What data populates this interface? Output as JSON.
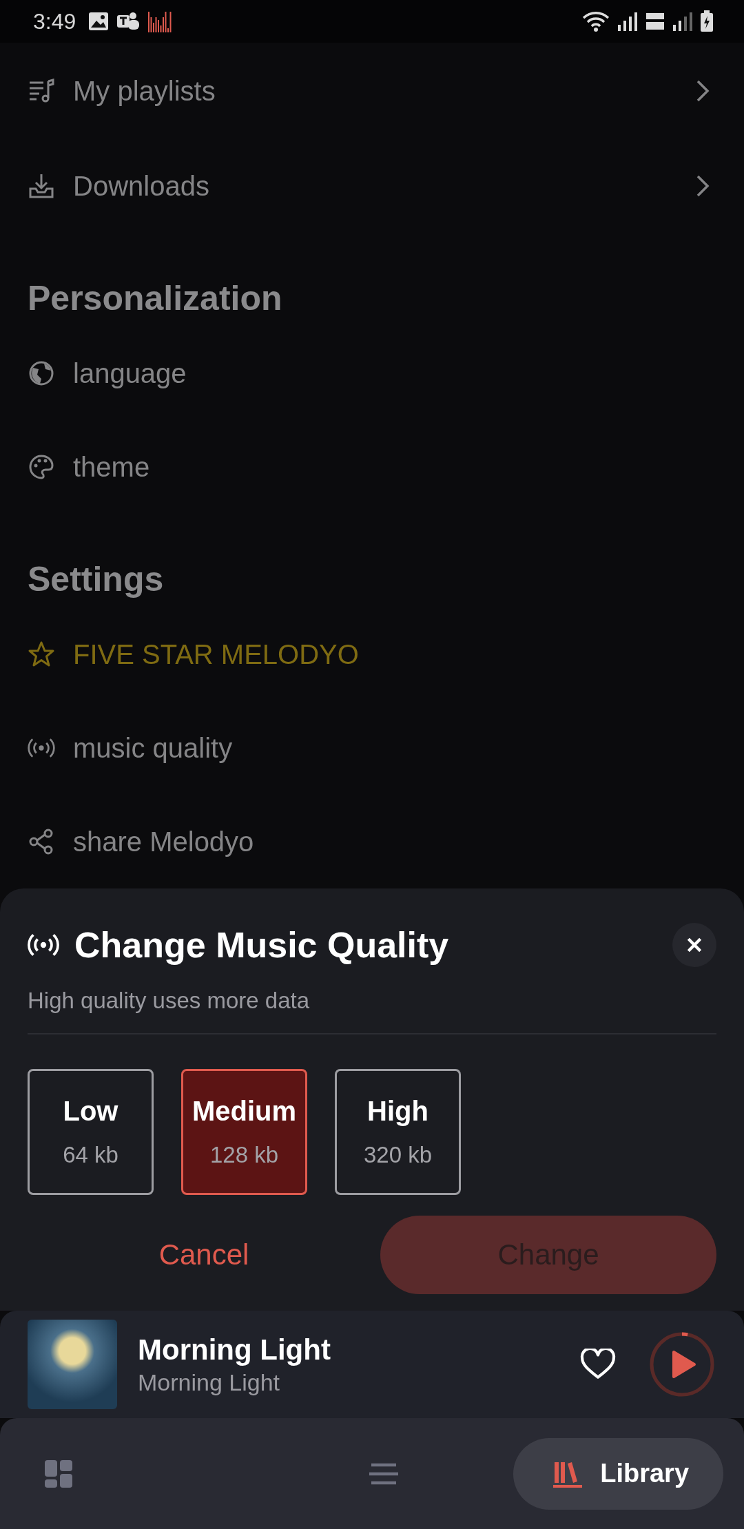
{
  "status_bar": {
    "time": "3:49"
  },
  "sections": [
    {
      "items": [
        {
          "label": "My playlists",
          "kind": "nav"
        },
        {
          "label": "Downloads",
          "kind": "nav"
        }
      ]
    },
    {
      "title": "Personalization",
      "items": [
        {
          "label": "language",
          "kind": "plain"
        },
        {
          "label": "theme",
          "kind": "plain"
        }
      ]
    },
    {
      "title": "Settings",
      "items": [
        {
          "label": "FIVE STAR MELODYO",
          "kind": "highlight"
        },
        {
          "label": "music quality",
          "kind": "plain"
        },
        {
          "label": "share Melodyo",
          "kind": "plain"
        }
      ]
    }
  ],
  "sheet": {
    "title": "Change Music Quality",
    "subtitle": "High quality uses more data",
    "options": [
      {
        "label": "Low",
        "rate": "64 kb",
        "selected": false
      },
      {
        "label": "Medium",
        "rate": "128 kb",
        "selected": true
      },
      {
        "label": "High",
        "rate": "320 kb",
        "selected": false
      }
    ],
    "cancel": "Cancel",
    "confirm": {
      "label": "Change",
      "disabled": true
    }
  },
  "player": {
    "title": "Morning Light",
    "artist": "Morning Light",
    "liked": false,
    "level": 0.03
  },
  "nav_tabs": [
    {
      "selected": false
    },
    {
      "selected": false
    },
    {
      "label": "Library",
      "selected": true
    }
  ]
}
